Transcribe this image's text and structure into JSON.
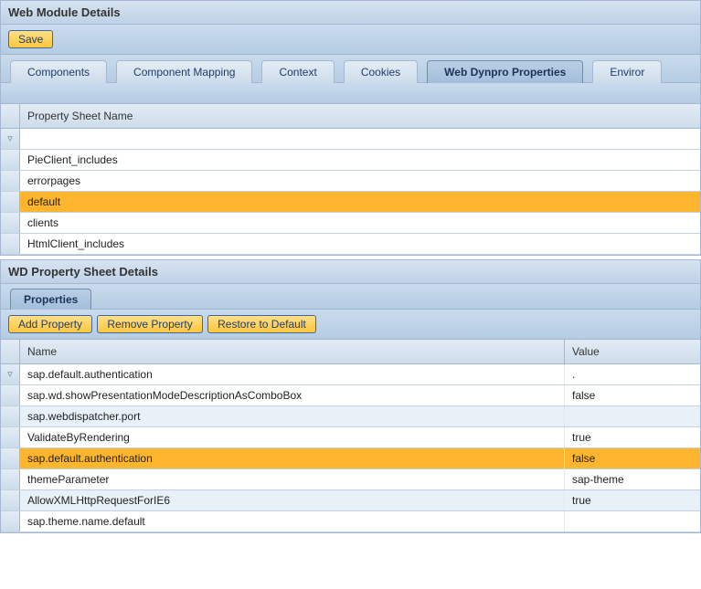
{
  "panel1": {
    "title": "Web Module Details",
    "save_label": "Save",
    "tabs": [
      {
        "label": "Components",
        "active": false
      },
      {
        "label": "Component Mapping",
        "active": false
      },
      {
        "label": "Context",
        "active": false
      },
      {
        "label": "Cookies",
        "active": false
      },
      {
        "label": "Web Dynpro Properties",
        "active": true
      },
      {
        "label": "Enviror",
        "active": false
      }
    ],
    "column_header": "Property Sheet Name",
    "rows": [
      {
        "name": "PieClient_includes",
        "selected": false
      },
      {
        "name": "errorpages",
        "selected": false
      },
      {
        "name": "default",
        "selected": true
      },
      {
        "name": "clients",
        "selected": false
      },
      {
        "name": "HtmlClient_includes",
        "selected": false
      }
    ]
  },
  "panel2": {
    "title": "WD Property Sheet Details",
    "tabs": [
      {
        "label": "Properties",
        "active": true
      }
    ],
    "buttons": {
      "add": "Add Property",
      "remove": "Remove Property",
      "restore": "Restore to Default"
    },
    "columns": {
      "name": "Name",
      "value": "Value"
    },
    "filter_value": "sap.default.authentication",
    "filter_value2": ".",
    "rows": [
      {
        "name": "sap.wd.showPresentationModeDescriptionAsComboBox",
        "value": "false",
        "selected": false,
        "alt": false
      },
      {
        "name": "sap.webdispatcher.port",
        "value": "",
        "selected": false,
        "alt": true
      },
      {
        "name": "ValidateByRendering",
        "value": "true",
        "selected": false,
        "alt": false
      },
      {
        "name": "sap.default.authentication",
        "value": "false",
        "selected": true,
        "alt": false
      },
      {
        "name": "themeParameter",
        "value": "sap-theme",
        "selected": false,
        "alt": false
      },
      {
        "name": "AllowXMLHttpRequestForIE6",
        "value": "true",
        "selected": false,
        "alt": true
      },
      {
        "name": "sap.theme.name.default",
        "value": "",
        "selected": false,
        "alt": false
      }
    ]
  }
}
